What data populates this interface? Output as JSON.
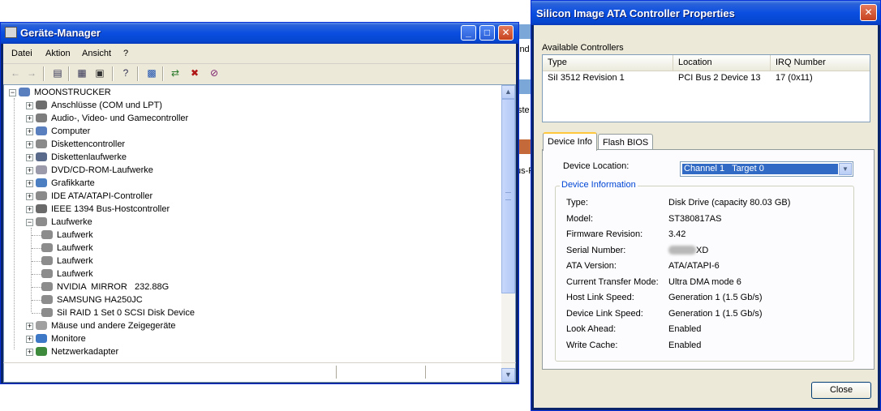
{
  "desktop": {
    "fragments": [
      "ind",
      "ste",
      "us-F"
    ]
  },
  "device_manager": {
    "title": "Geräte-Manager",
    "menu": [
      "Datei",
      "Aktion",
      "Ansicht",
      "?"
    ],
    "tree": [
      {
        "label": "MOONSTRUCKER",
        "level": 0,
        "icon": "computer-icon",
        "expander": "−"
      },
      {
        "label": "Anschlüsse (COM und LPT)",
        "level": 1,
        "icon": "port-icon",
        "expander": "+"
      },
      {
        "label": "Audio-, Video- und Gamecontroller",
        "level": 1,
        "icon": "audio-icon",
        "expander": "+"
      },
      {
        "label": "Computer",
        "level": 1,
        "icon": "computer-icon",
        "expander": "+"
      },
      {
        "label": "Diskettencontroller",
        "level": 1,
        "icon": "controller-icon",
        "expander": "+"
      },
      {
        "label": "Diskettenlaufwerke",
        "level": 1,
        "icon": "floppy-icon",
        "expander": "+"
      },
      {
        "label": "DVD/CD-ROM-Laufwerke",
        "level": 1,
        "icon": "cdrom-icon",
        "expander": "+"
      },
      {
        "label": "Grafikkarte",
        "level": 1,
        "icon": "display-icon",
        "expander": "+"
      },
      {
        "label": "IDE ATA/ATAPI-Controller",
        "level": 1,
        "icon": "controller-icon",
        "expander": "+"
      },
      {
        "label": "IEEE 1394 Bus-Hostcontroller",
        "level": 1,
        "icon": "firewire-icon",
        "expander": "+"
      },
      {
        "label": "Laufwerke",
        "level": 1,
        "icon": "disk-icon",
        "expander": "−"
      },
      {
        "label": "Laufwerk",
        "level": 2,
        "icon": "disk-icon",
        "expander": ""
      },
      {
        "label": "Laufwerk",
        "level": 2,
        "icon": "disk-icon",
        "expander": ""
      },
      {
        "label": "Laufwerk",
        "level": 2,
        "icon": "disk-icon",
        "expander": ""
      },
      {
        "label": "Laufwerk",
        "level": 2,
        "icon": "disk-icon",
        "expander": ""
      },
      {
        "label": "NVIDIA  MIRROR   232.88G",
        "level": 2,
        "icon": "disk-icon",
        "expander": ""
      },
      {
        "label": "SAMSUNG HA250JC",
        "level": 2,
        "icon": "disk-icon",
        "expander": ""
      },
      {
        "label": "SiI RAID 1 Set 0 SCSI Disk Device",
        "level": 2,
        "icon": "disk-icon",
        "expander": ""
      },
      {
        "label": "Mäuse und andere Zeigegeräte",
        "level": 1,
        "icon": "mouse-icon",
        "expander": "+"
      },
      {
        "label": "Monitore",
        "level": 1,
        "icon": "monitor-icon",
        "expander": "+"
      },
      {
        "label": "Netzwerkadapter",
        "level": 1,
        "icon": "network-icon",
        "expander": "+"
      }
    ]
  },
  "properties": {
    "title": "Silicon Image ATA Controller Properties",
    "available_label": "Available Controllers",
    "columns": [
      "Type",
      "Location",
      "IRQ Number"
    ],
    "rows": [
      [
        "SiI 3512 Revision 1",
        "PCI Bus 2 Device 13",
        "17 (0x11)"
      ]
    ],
    "tabs": [
      "Device Info",
      "Flash BIOS"
    ],
    "device_location_label": "Device Location:",
    "device_location_value": "Channel 1   Target 0",
    "info_group_label": "Device Information",
    "info": [
      {
        "label": "Type:",
        "value": "Disk Drive (capacity 80.03 GB)"
      },
      {
        "label": "Model:",
        "value": "ST380817AS"
      },
      {
        "label": "Firmware Revision:",
        "value": "3.42"
      },
      {
        "label": "Serial Number:",
        "value": "XD"
      },
      {
        "label": "ATA Version:",
        "value": "ATA/ATAPI-6"
      },
      {
        "label": "Current Transfer Mode:",
        "value": "Ultra DMA mode 6"
      },
      {
        "label": "Host Link Speed:",
        "value": "Generation 1 (1.5 Gb/s)"
      },
      {
        "label": "Device Link Speed:",
        "value": "Generation 1 (1.5 Gb/s)"
      },
      {
        "label": "Look Ahead:",
        "value": "Enabled"
      },
      {
        "label": "Write Cache:",
        "value": "Enabled"
      }
    ],
    "close_label": "Close"
  }
}
